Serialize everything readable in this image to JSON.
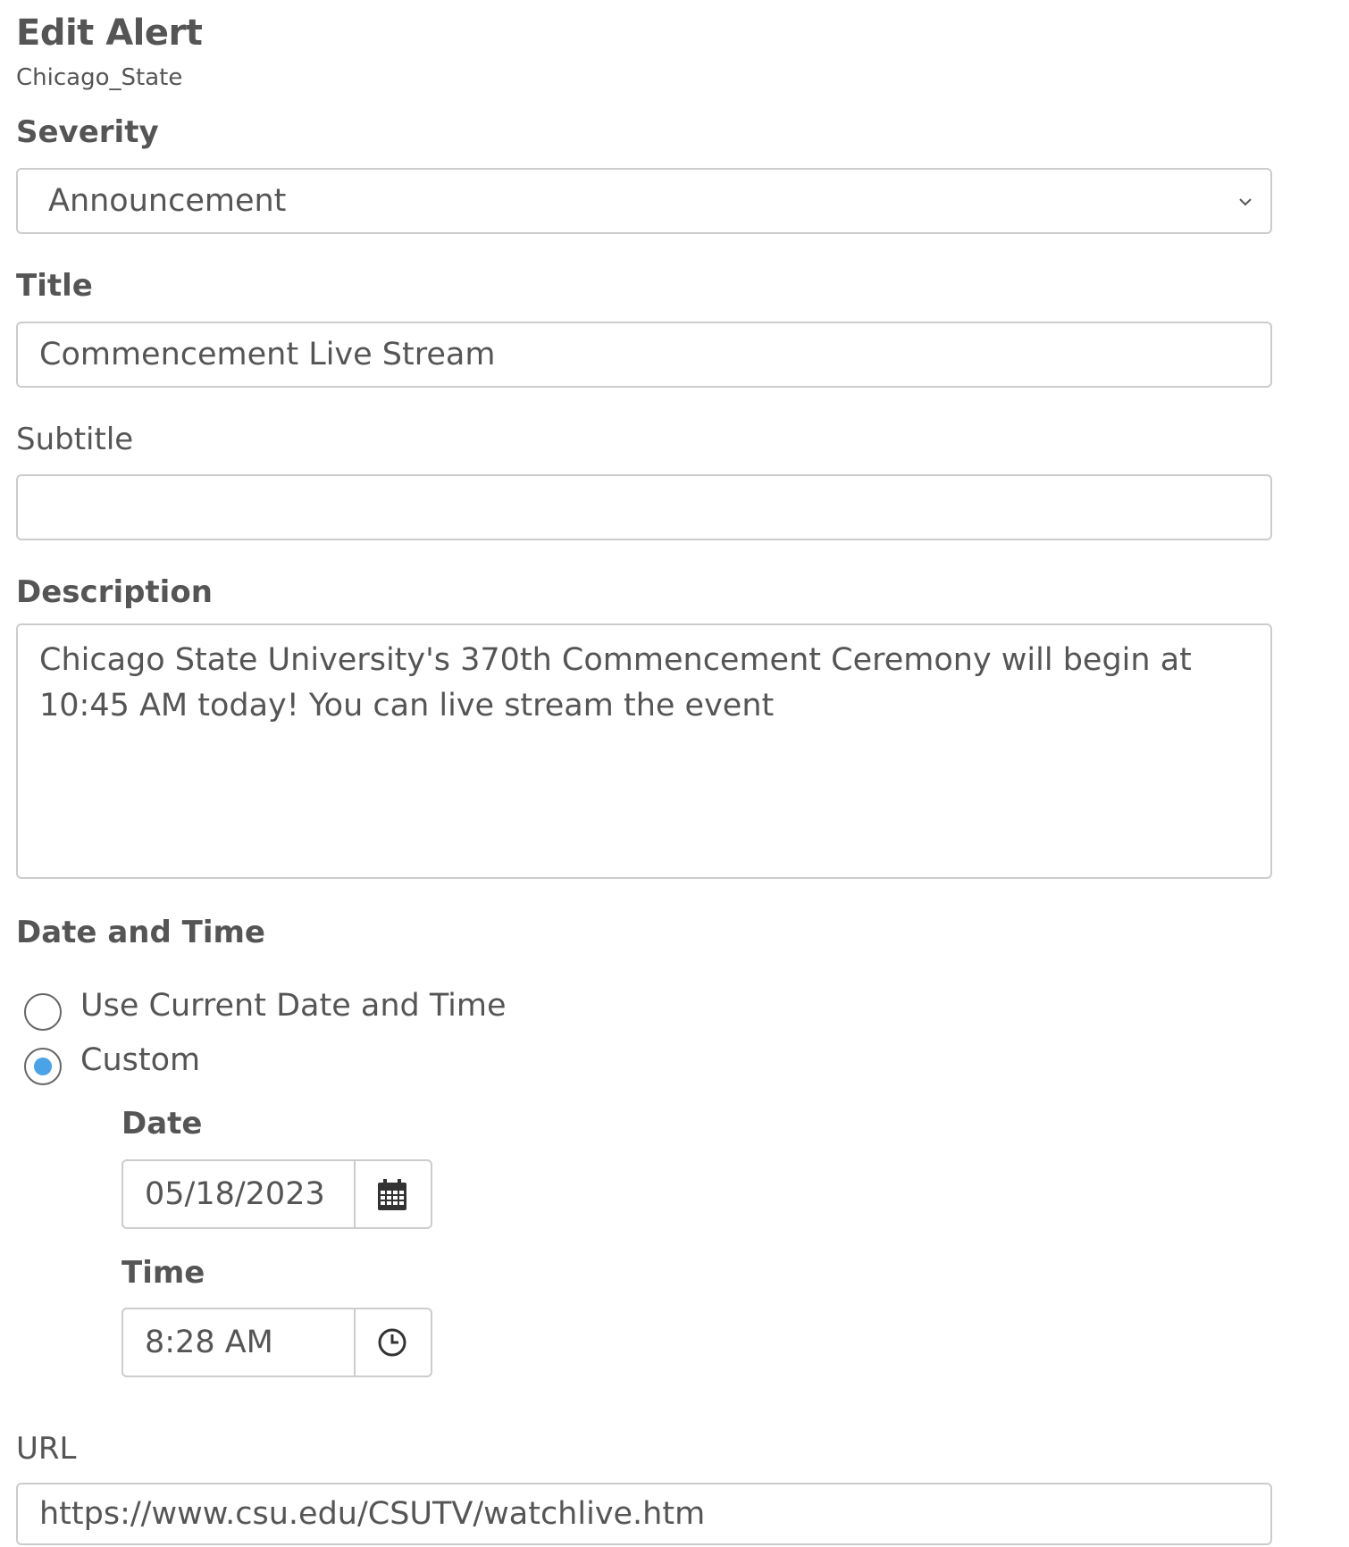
{
  "header": {
    "title": "Edit Alert",
    "subtitle": "Chicago_State"
  },
  "severity": {
    "label": "Severity",
    "selected": "Announcement",
    "icon": "chevron-down-icon"
  },
  "title_field": {
    "label": "Title",
    "value": "Commencement Live Stream"
  },
  "subtitle_field": {
    "label": "Subtitle",
    "value": ""
  },
  "description": {
    "label": "Description",
    "value": "Chicago State University's 370th Commencement Ceremony will begin at 10:45 AM today! You can live stream the event"
  },
  "date_time": {
    "label": "Date and Time",
    "options": [
      {
        "label": "Use Current Date and Time",
        "selected": false
      },
      {
        "label": "Custom",
        "selected": true
      }
    ],
    "date": {
      "label": "Date",
      "value": "05/18/2023",
      "icon": "calendar-icon"
    },
    "time": {
      "label": "Time",
      "value": "8:28 AM",
      "icon": "clock-icon"
    }
  },
  "url": {
    "label": "URL",
    "value": "https://www.csu.edu/CSUTV/watchlive.htm"
  },
  "colors": {
    "text": "#555555",
    "border": "#cccccc",
    "radio_selected": "#4aa3e8"
  }
}
